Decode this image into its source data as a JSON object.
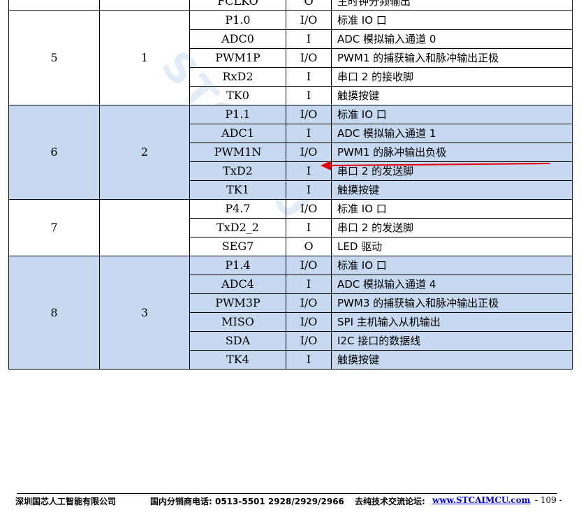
{
  "watermark": "STCMCU",
  "table": {
    "top_row": {
      "name": "FCLKO",
      "dir": "O",
      "desc": "主时钟分频输出"
    },
    "groups": [
      {
        "pin_a": "5",
        "pin_b": "1",
        "rows": [
          {
            "name": "P1.0",
            "dir": "I/O",
            "desc": "标准 IO 口"
          },
          {
            "name": "ADC0",
            "dir": "I",
            "desc": "ADC 模拟输入通道 0"
          },
          {
            "name": "PWM1P",
            "dir": "I/O",
            "desc": "PWM1 的捕获输入和脉冲输出正极"
          },
          {
            "name": "RxD2",
            "dir": "I",
            "desc": "串口 2 的接收脚"
          },
          {
            "name": "TK0",
            "dir": "I",
            "desc": "触摸按键"
          }
        ]
      },
      {
        "pin_a": "6",
        "pin_b": "2",
        "rows": [
          {
            "name": "P1.1",
            "dir": "I/O",
            "desc": "标准 IO 口"
          },
          {
            "name": "ADC1",
            "dir": "I",
            "desc": "ADC 模拟输入通道 1"
          },
          {
            "name": "PWM1N",
            "dir": "I/O",
            "desc": "PWM1 的脉冲输出负极"
          },
          {
            "name": "TxD2",
            "dir": "I",
            "desc": "串口 2 的发送脚"
          },
          {
            "name": "TK1",
            "dir": "I",
            "desc": "触摸按键"
          }
        ]
      },
      {
        "pin_a": "7",
        "pin_b": "",
        "rows": [
          {
            "name": "P4.7",
            "dir": "I/O",
            "desc": "标准 IO 口"
          },
          {
            "name": "TxD2_2",
            "dir": "I",
            "desc": "串口 2 的发送脚"
          },
          {
            "name": "SEG7",
            "dir": "O",
            "desc": "LED 驱动"
          }
        ]
      },
      {
        "pin_a": "8",
        "pin_b": "3",
        "rows": [
          {
            "name": "P1.4",
            "dir": "I/O",
            "desc": "标准 IO 口"
          },
          {
            "name": "ADC4",
            "dir": "I",
            "desc": "ADC 模拟输入通道 4"
          },
          {
            "name": "PWM3P",
            "dir": "I/O",
            "desc": "PWM3 的捕获输入和脉冲输出正极"
          },
          {
            "name": "MISO",
            "dir": "I/O",
            "desc": "SPI 主机输入从机输出"
          },
          {
            "name": "SDA",
            "dir": "I/O",
            "desc": "I2C 接口的数据线"
          },
          {
            "name": "TK4",
            "dir": "I",
            "desc": "触摸按键"
          }
        ]
      }
    ]
  },
  "annotation": {
    "arrow_color": "#e8000b"
  },
  "colors": {
    "shade": "#c6d9f0",
    "link": "#0000ee"
  },
  "footer": {
    "company": "深圳国芯人工智能有限公司",
    "phone": "国内分销商电话: 0513-5501 2928/2929/2966",
    "forum_label": "去纯技术交流论坛:",
    "forum_url": "www.STCAIMCU.com",
    "page": "- 109 -"
  }
}
